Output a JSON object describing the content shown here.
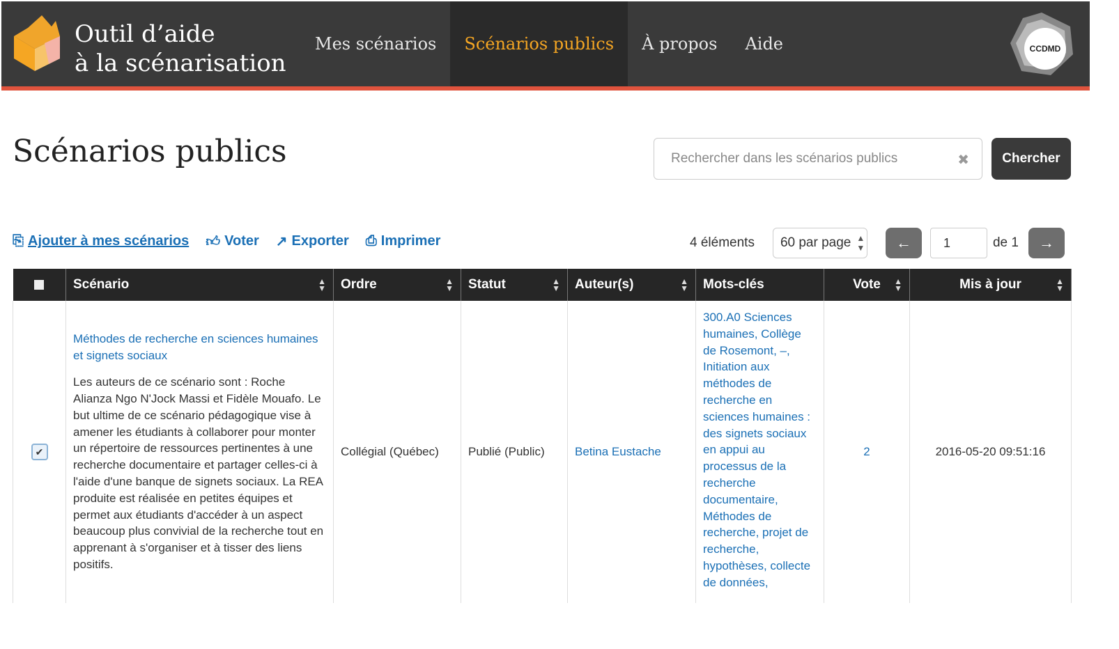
{
  "header": {
    "brand_line1": "Outil d’aide",
    "brand_line2": "à la scénarisation",
    "nav": [
      {
        "label": "Mes scénarios"
      },
      {
        "label": "Scénarios publics"
      },
      {
        "label": "À propos"
      },
      {
        "label": "Aide"
      }
    ],
    "ccdmd_label": "CCDMD",
    "accent_color": "#f5a623",
    "bar_color": "#e0533d"
  },
  "page": {
    "title": "Scénarios publics"
  },
  "search": {
    "placeholder": "Rechercher dans les scénarios publics",
    "button": "Chercher"
  },
  "actions": {
    "add": "Ajouter à mes scénarios",
    "vote": "Voter",
    "export": "Exporter",
    "print": "Imprimer"
  },
  "pagination": {
    "count": "4 éléments",
    "per_page": "60 par page",
    "current_page": "1",
    "of_pages": "de 1"
  },
  "table": {
    "columns": [
      "Scénario",
      "Ordre",
      "Statut",
      "Auteur(s)",
      "Mots-clés",
      "Vote",
      "Mis à jour"
    ],
    "rows": [
      {
        "title": "Méthodes de recherche en sciences humaines et signets sociaux",
        "description": "Les auteurs de ce scénario sont : Roche Alianza Ngo N'Jock Massi et Fidèle Mouafo. Le but ultime de ce scénario pédagogique vise à amener les étudiants à collaborer pour monter un répertoire de ressources pertinentes à une recherche documentaire et partager celles-ci à l'aide d'une banque de signets sociaux. La REA produite est réalisée en petites équipes et permet aux étudiants d'accéder à un aspect beaucoup plus convivial de la recherche tout en apprenant à s'organiser et à tisser des liens positifs.",
        "order": "Collégial (Québec)",
        "status": "Publié (Public)",
        "author": "Betina Eustache",
        "keywords": "300.A0 Sciences humaines, Collège de Rosemont, –, Initiation aux méthodes de recherche en sciences humaines : des signets sociaux en appui au processus de la recherche documentaire, Méthodes de recherche, projet de recherche, hypothèses, collecte de données,",
        "vote": "2",
        "updated": "2016-05-20 09:51:16",
        "checked": true
      }
    ]
  }
}
